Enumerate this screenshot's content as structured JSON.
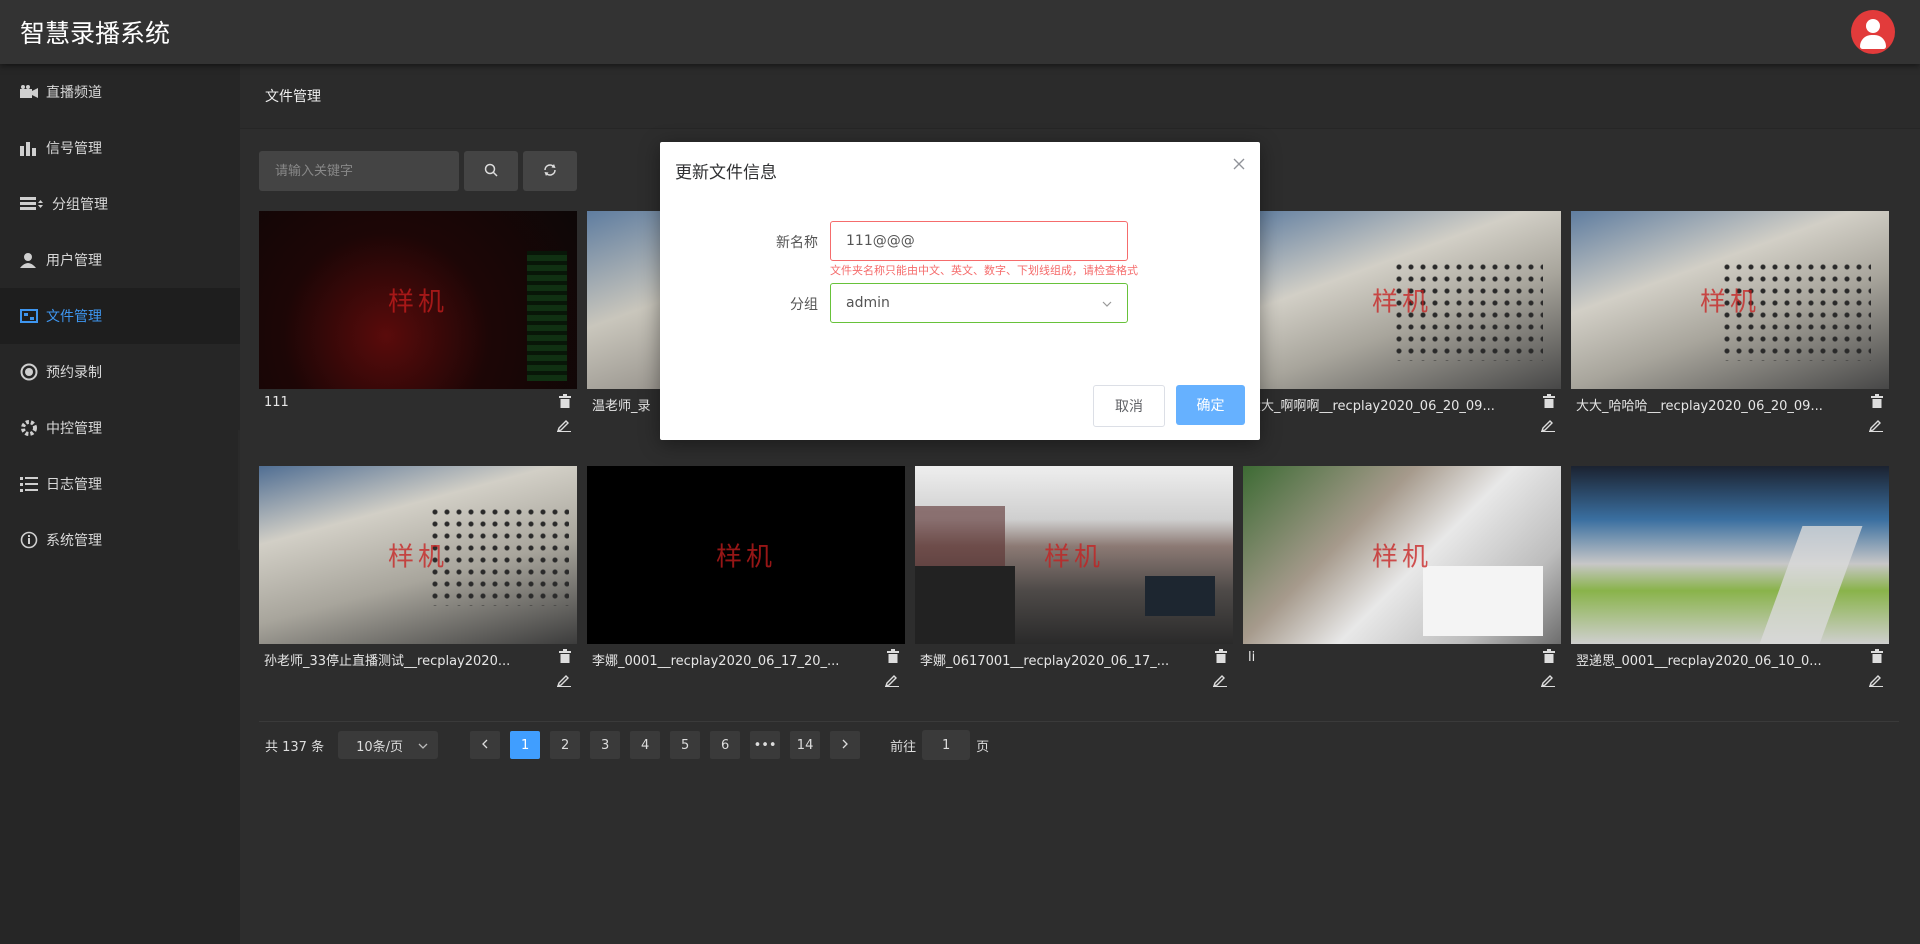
{
  "app": {
    "title": "智慧录播系统"
  },
  "sidebar": {
    "items": [
      {
        "label": "直播频道",
        "icon": "video-camera-icon"
      },
      {
        "label": "信号管理",
        "icon": "bar-chart-icon"
      },
      {
        "label": "分组管理",
        "icon": "group-list-icon"
      },
      {
        "label": "用户管理",
        "icon": "user-icon"
      },
      {
        "label": "文件管理",
        "icon": "film-icon",
        "active": true
      },
      {
        "label": "预约录制",
        "icon": "record-icon"
      },
      {
        "label": "中控管理",
        "icon": "gear-icon"
      },
      {
        "label": "日志管理",
        "icon": "list-icon"
      },
      {
        "label": "系统管理",
        "icon": "info-icon"
      }
    ]
  },
  "breadcrumb": {
    "current": "文件管理"
  },
  "search": {
    "placeholder": "请输入关键字",
    "value": ""
  },
  "files": [
    {
      "title": "111",
      "thumb": "dark-red"
    },
    {
      "title": "温老师_录",
      "thumb": "server"
    },
    {
      "title": "",
      "thumb": "server"
    },
    {
      "title": "大大_啊啊啊__recplay2020_06_20_09...",
      "thumb": "server"
    },
    {
      "title": "大大_哈哈哈__recplay2020_06_20_09...",
      "thumb": "server"
    },
    {
      "title": "孙老师_33停止直播测试__recplay2020...",
      "thumb": "server"
    },
    {
      "title": "李娜_0001__recplay2020_06_17_20_...",
      "thumb": "black"
    },
    {
      "title": "李娜_0617001__recplay2020_06_17_...",
      "thumb": "office"
    },
    {
      "title": "li",
      "thumb": "plant"
    },
    {
      "title": "翌递思_0001__recplay2020_06_10_0...",
      "thumb": "openoffice"
    }
  ],
  "watermark": "样机",
  "pagination": {
    "total_text": "共 137 条",
    "page_size": "10条/页",
    "pages": [
      "1",
      "2",
      "3",
      "4",
      "5",
      "6",
      "•••",
      "14"
    ],
    "current": "1",
    "goto_prefix": "前往",
    "goto_value": "1",
    "goto_suffix": "页"
  },
  "dialog": {
    "title": "更新文件信息",
    "name_label": "新名称",
    "name_value": "111@@@",
    "error_text": "文件夹名称只能由中文、英文、数字、下划线组成，请检查格式",
    "group_label": "分组",
    "group_value": "admin",
    "cancel_label": "取消",
    "ok_label": "确定"
  },
  "colors": {
    "accent": "#409eff",
    "active_menu": "#3e96f0",
    "error": "#f56c6c",
    "success": "#67c23a",
    "avatar": "#e23b3b"
  }
}
